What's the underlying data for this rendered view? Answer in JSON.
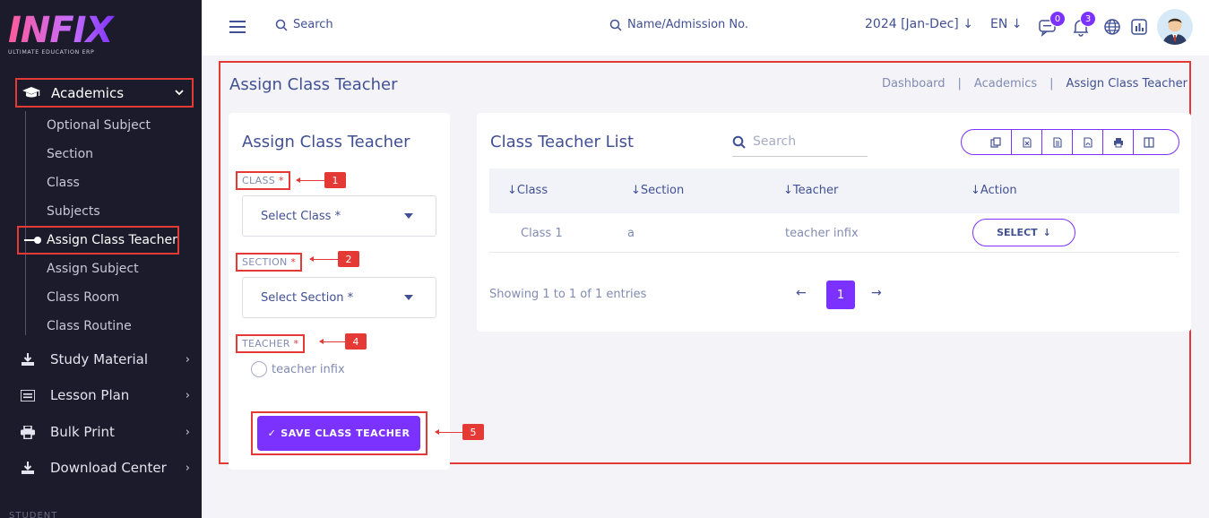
{
  "brand": {
    "logo_text": "INFIX",
    "logo_sub": "ULTIMATE EDUCATION ERP"
  },
  "sidebar": {
    "section": {
      "label": "Academics",
      "icon": "graduation-cap-icon"
    },
    "sub_items": [
      {
        "label": "Optional Subject"
      },
      {
        "label": "Section"
      },
      {
        "label": "Class"
      },
      {
        "label": "Subjects"
      },
      {
        "label": "Assign Class Teacher",
        "active": true
      },
      {
        "label": "Assign Subject"
      },
      {
        "label": "Class Room"
      },
      {
        "label": "Class Routine"
      }
    ],
    "main_items": [
      {
        "label": "Study Material",
        "icon": "download-icon"
      },
      {
        "label": "Lesson Plan",
        "icon": "list-icon"
      },
      {
        "label": "Bulk Print",
        "icon": "printer-icon"
      },
      {
        "label": "Download Center",
        "icon": "download-icon"
      }
    ],
    "cut_label": "STUDENT"
  },
  "topbar": {
    "search_label": "Search",
    "search2_label": "Name/Admission No.",
    "year": "2024 [Jan-Dec]",
    "lang": "EN",
    "messages_count": "0",
    "notifications_count": "3"
  },
  "page": {
    "title": "Assign Class Teacher",
    "breadcrumb": [
      "Dashboard",
      "Academics",
      "Assign Class Teacher"
    ]
  },
  "form": {
    "title": "Assign Class Teacher",
    "class_label": "CLASS",
    "class_placeholder": "Select Class *",
    "section_label": "SECTION",
    "section_placeholder": "Select Section *",
    "teacher_label": "TEACHER",
    "teacher_option": "teacher infix",
    "required_mark": "*",
    "save_label": "SAVE CLASS TEACHER"
  },
  "callouts": [
    "1",
    "2",
    "4",
    "5"
  ],
  "list": {
    "title": "Class Teacher List",
    "search_placeholder": "Search",
    "columns": [
      "Class",
      "Section",
      "Teacher",
      "Action"
    ],
    "rows": [
      {
        "class": "Class 1",
        "section": "a",
        "teacher": "teacher infix",
        "action": "SELECT"
      }
    ],
    "showing": "Showing 1 to 1 of 1 entries",
    "current_page": "1",
    "export_icons": [
      "copy-icon",
      "excel-icon",
      "csv-icon",
      "pdf-icon",
      "print-icon",
      "columns-icon"
    ]
  },
  "colors": {
    "accent": "#7c32ff",
    "sidebar_bg": "#1b1b2b",
    "annotation_red": "#e53935",
    "text_primary": "#415094"
  }
}
